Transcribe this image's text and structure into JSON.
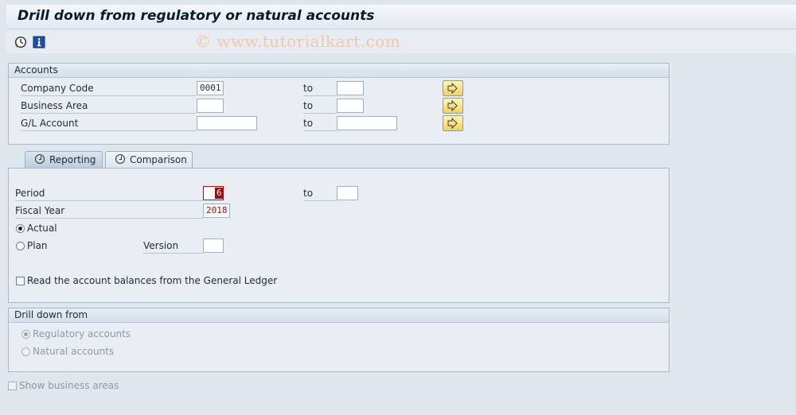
{
  "title": "Drill down from regulatory or natural accounts",
  "watermark": "© www.tutorialkart.com",
  "toolbar": {
    "icons": [
      "execute-icon",
      "info-icon"
    ]
  },
  "accounts": {
    "header": "Accounts",
    "rows": [
      {
        "label": "Company Code",
        "from": "0001",
        "to_label": "to",
        "to": ""
      },
      {
        "label": "Business Area",
        "from": "",
        "to_label": "to",
        "to": ""
      },
      {
        "label": "G/L Account",
        "from": "",
        "to_label": "to",
        "to": ""
      }
    ]
  },
  "tabs": [
    {
      "label": "Reporting",
      "active": true
    },
    {
      "label": "Comparison",
      "active": false
    }
  ],
  "reporting": {
    "period_label": "Period",
    "period_value": "6",
    "period_to_label": "to",
    "period_to_value": "",
    "fiscal_year_label": "Fiscal Year",
    "fiscal_year_value": "2018",
    "actual_label": "Actual",
    "plan_label": "Plan",
    "version_label": "Version",
    "version_value": "",
    "ledger_checkbox_label": "Read the account balances from the General Ledger"
  },
  "drilldown": {
    "header": "Drill down from",
    "regulatory_label": "Regulatory accounts",
    "natural_label": "Natural accounts"
  },
  "show_business_areas_label": "Show business areas"
}
